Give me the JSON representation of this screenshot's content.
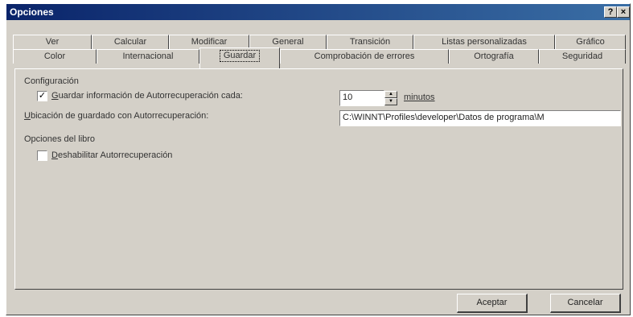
{
  "window": {
    "title": "Opciones",
    "help_glyph": "?",
    "close_glyph": "×"
  },
  "tabs_row1": [
    "Ver",
    "Calcular",
    "Modificar",
    "General",
    "Transición",
    "Listas personalizadas",
    "Gráfico"
  ],
  "tabs_row2": [
    "Color",
    "Internacional",
    "Guardar",
    "Comprobación de errores",
    "Ortografía",
    "Seguridad"
  ],
  "active_tab": "Guardar",
  "config": {
    "section_label": "Configuración",
    "autosave_checked": true,
    "autosave_label_accesskey": "G",
    "autosave_label_rest": "uardar información de Autorrecuperación cada:",
    "autosave_minutes": "10",
    "minutes_label": "minutos",
    "location_label_accesskey": "U",
    "location_label_rest": "bicación de guardado con Autorrecuperación:",
    "location_value": "C:\\WINNT\\Profiles\\developer\\Datos de programa\\M"
  },
  "book": {
    "section_label": "Opciones del libro",
    "disable_checked": false,
    "disable_label_accesskey": "D",
    "disable_label_rest": "eshabilitar Autorrecuperación"
  },
  "buttons": {
    "ok": "Aceptar",
    "cancel": "Cancelar"
  }
}
